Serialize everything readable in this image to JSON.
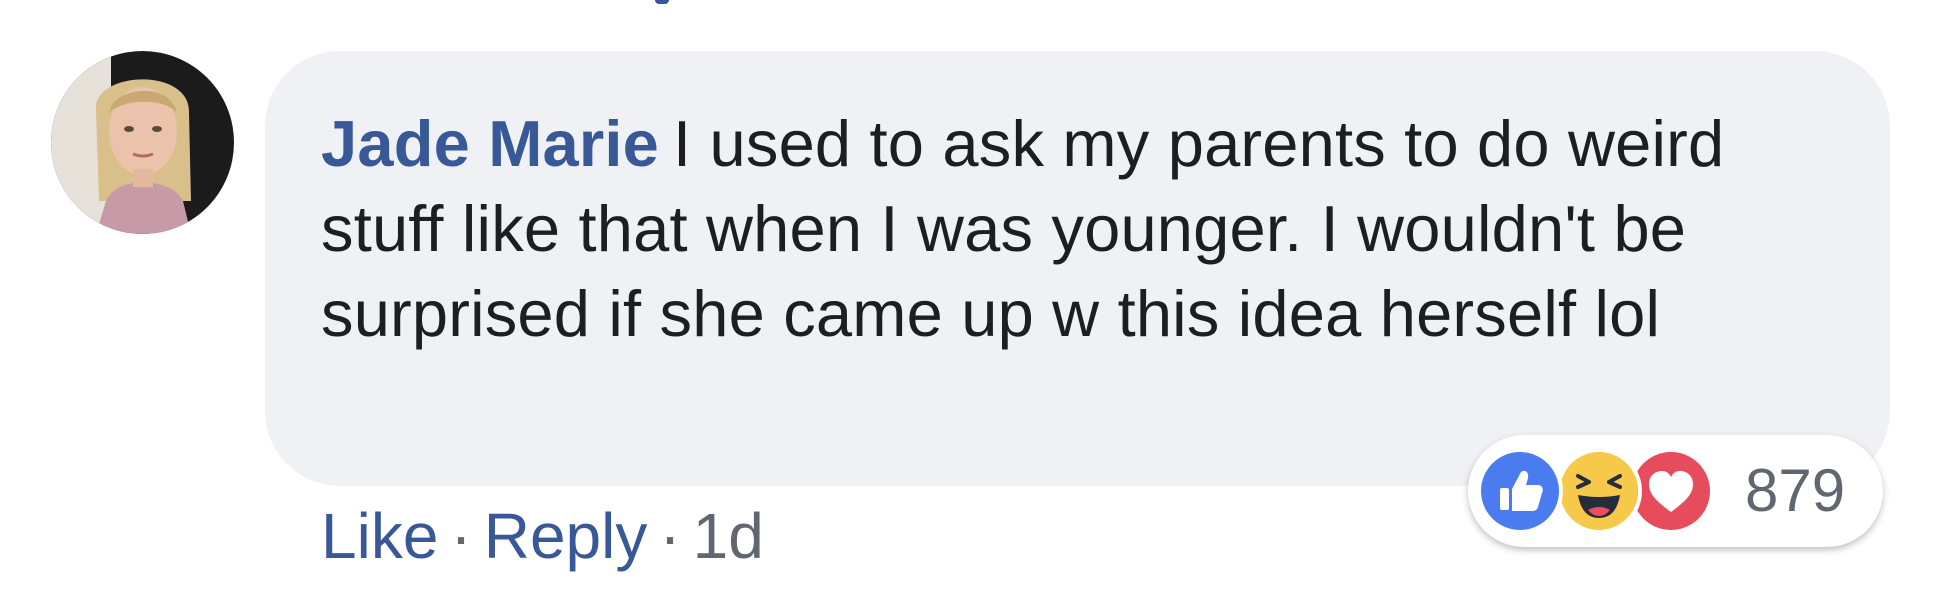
{
  "comment": {
    "author": "Jade Marie",
    "text": "I used to ask my parents to do weird stuff like that when I was younger. I wouldn't be surprised if she came up w this idea herself lol",
    "avatar_icon": "profile-photo"
  },
  "actions": {
    "like_label": "Like",
    "reply_label": "Reply",
    "separator": "·",
    "time": "1d"
  },
  "reactions": {
    "icons": [
      "like-icon",
      "haha-icon",
      "love-icon"
    ],
    "count": "879"
  },
  "colors": {
    "link": "#385898",
    "bubble": "#f0f1f4",
    "text": "#1c1e21",
    "meta": "#606770",
    "like": "#4a7cf0",
    "haha": "#f7c94a",
    "love": "#e74c5c"
  }
}
